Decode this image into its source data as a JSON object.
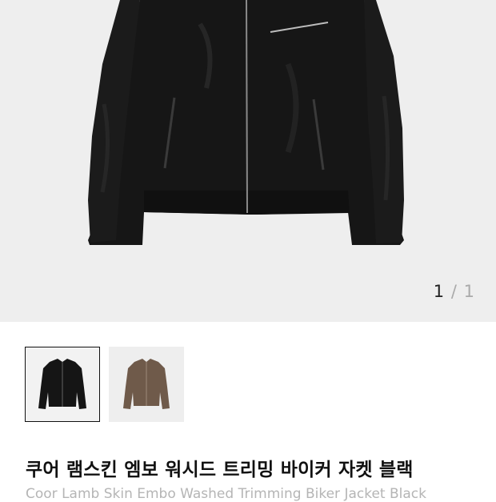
{
  "gallery": {
    "current": "1",
    "separator": "/",
    "total": "1"
  },
  "thumbnails": [
    {
      "color": "black",
      "selected": true
    },
    {
      "color": "brown",
      "selected": false
    }
  ],
  "product": {
    "title_ko": "쿠어 램스킨 엠보 워시드 트리밍 바이커 자켓 블랙",
    "title_en": "Coor Lamb Skin Embo Washed Trimming Biker Jacket Black"
  },
  "colors": {
    "hero_background": "#eeeeee",
    "jacket_black": "#161616",
    "jacket_brown": "#6f5a4a",
    "title": "#111111",
    "subtitle": "#b5b5b5"
  }
}
